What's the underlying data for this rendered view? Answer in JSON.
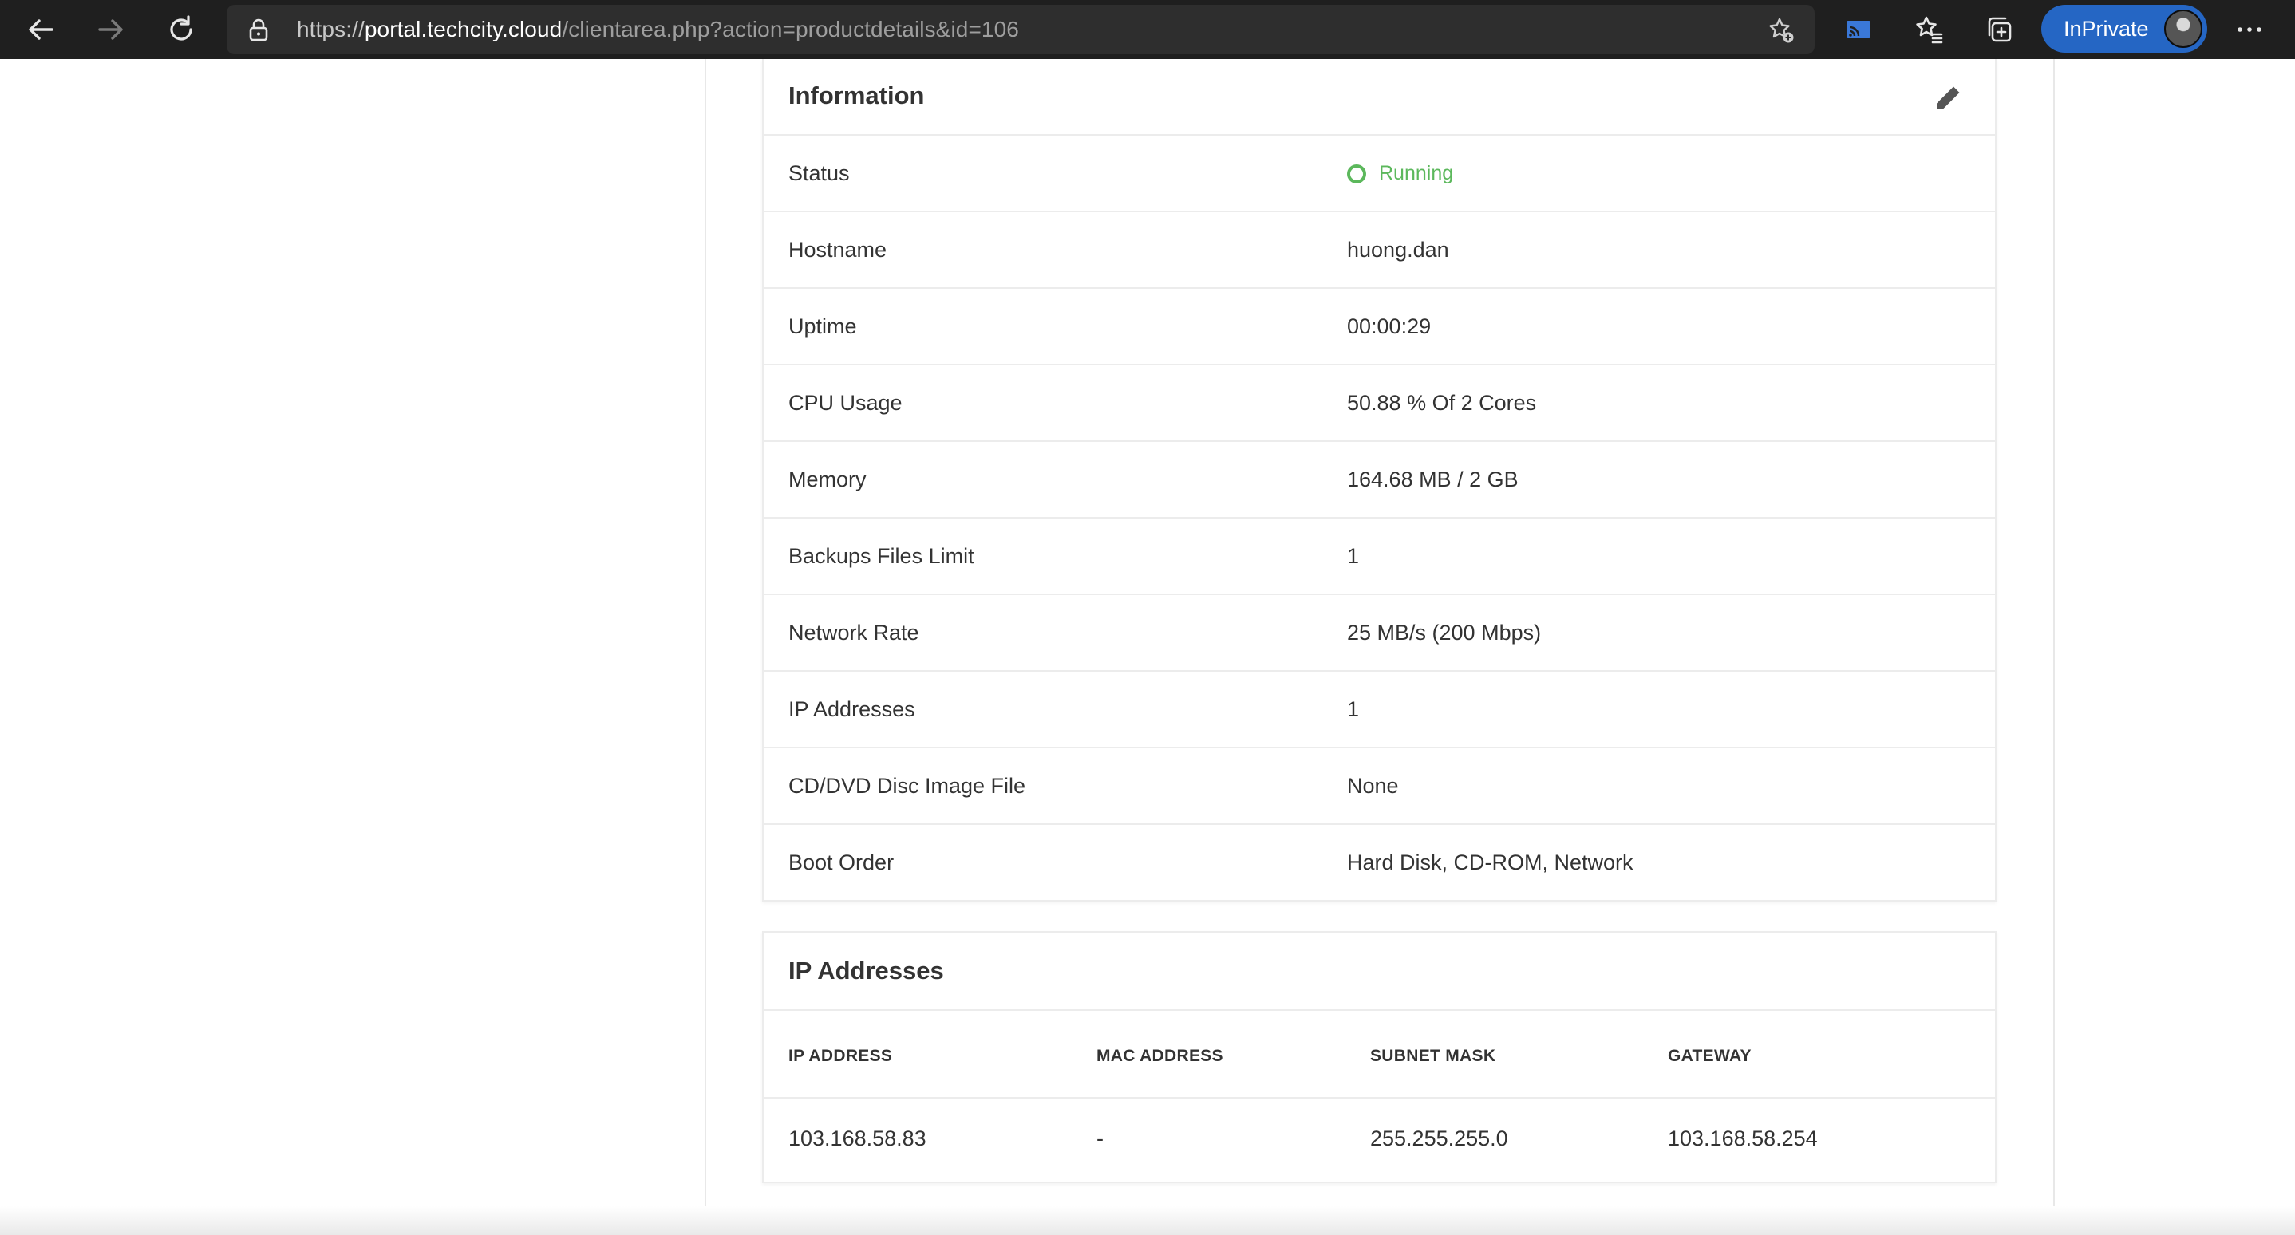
{
  "browser": {
    "url_scheme": "https://",
    "url_host": "portal.techcity.cloud",
    "url_path": "/clientarea.php?action=productdetails&id=106",
    "inprivate_label": "InPrivate"
  },
  "information": {
    "title": "Information",
    "rows": [
      {
        "label": "Status",
        "value": "Running"
      },
      {
        "label": "Hostname",
        "value": "huong.dan"
      },
      {
        "label": "Uptime",
        "value": "00:00:29"
      },
      {
        "label": "CPU Usage",
        "value": "50.88 % Of 2 Cores"
      },
      {
        "label": "Memory",
        "value": "164.68 MB / 2 GB"
      },
      {
        "label": "Backups Files Limit",
        "value": "1"
      },
      {
        "label": "Network Rate",
        "value": "25 MB/s (200 Mbps)"
      },
      {
        "label": "IP Addresses",
        "value": "1"
      },
      {
        "label": "CD/DVD Disc Image File",
        "value": "None"
      },
      {
        "label": "Boot Order",
        "value": "Hard Disk, CD-ROM, Network"
      }
    ],
    "status_color": "#5cb85c"
  },
  "ip_addresses": {
    "title": "IP Addresses",
    "columns": [
      "IP ADDRESS",
      "MAC ADDRESS",
      "SUBNET MASK",
      "GATEWAY"
    ],
    "rows": [
      [
        "103.168.58.83",
        "-",
        "255.255.255.0",
        "103.168.58.254"
      ]
    ]
  }
}
